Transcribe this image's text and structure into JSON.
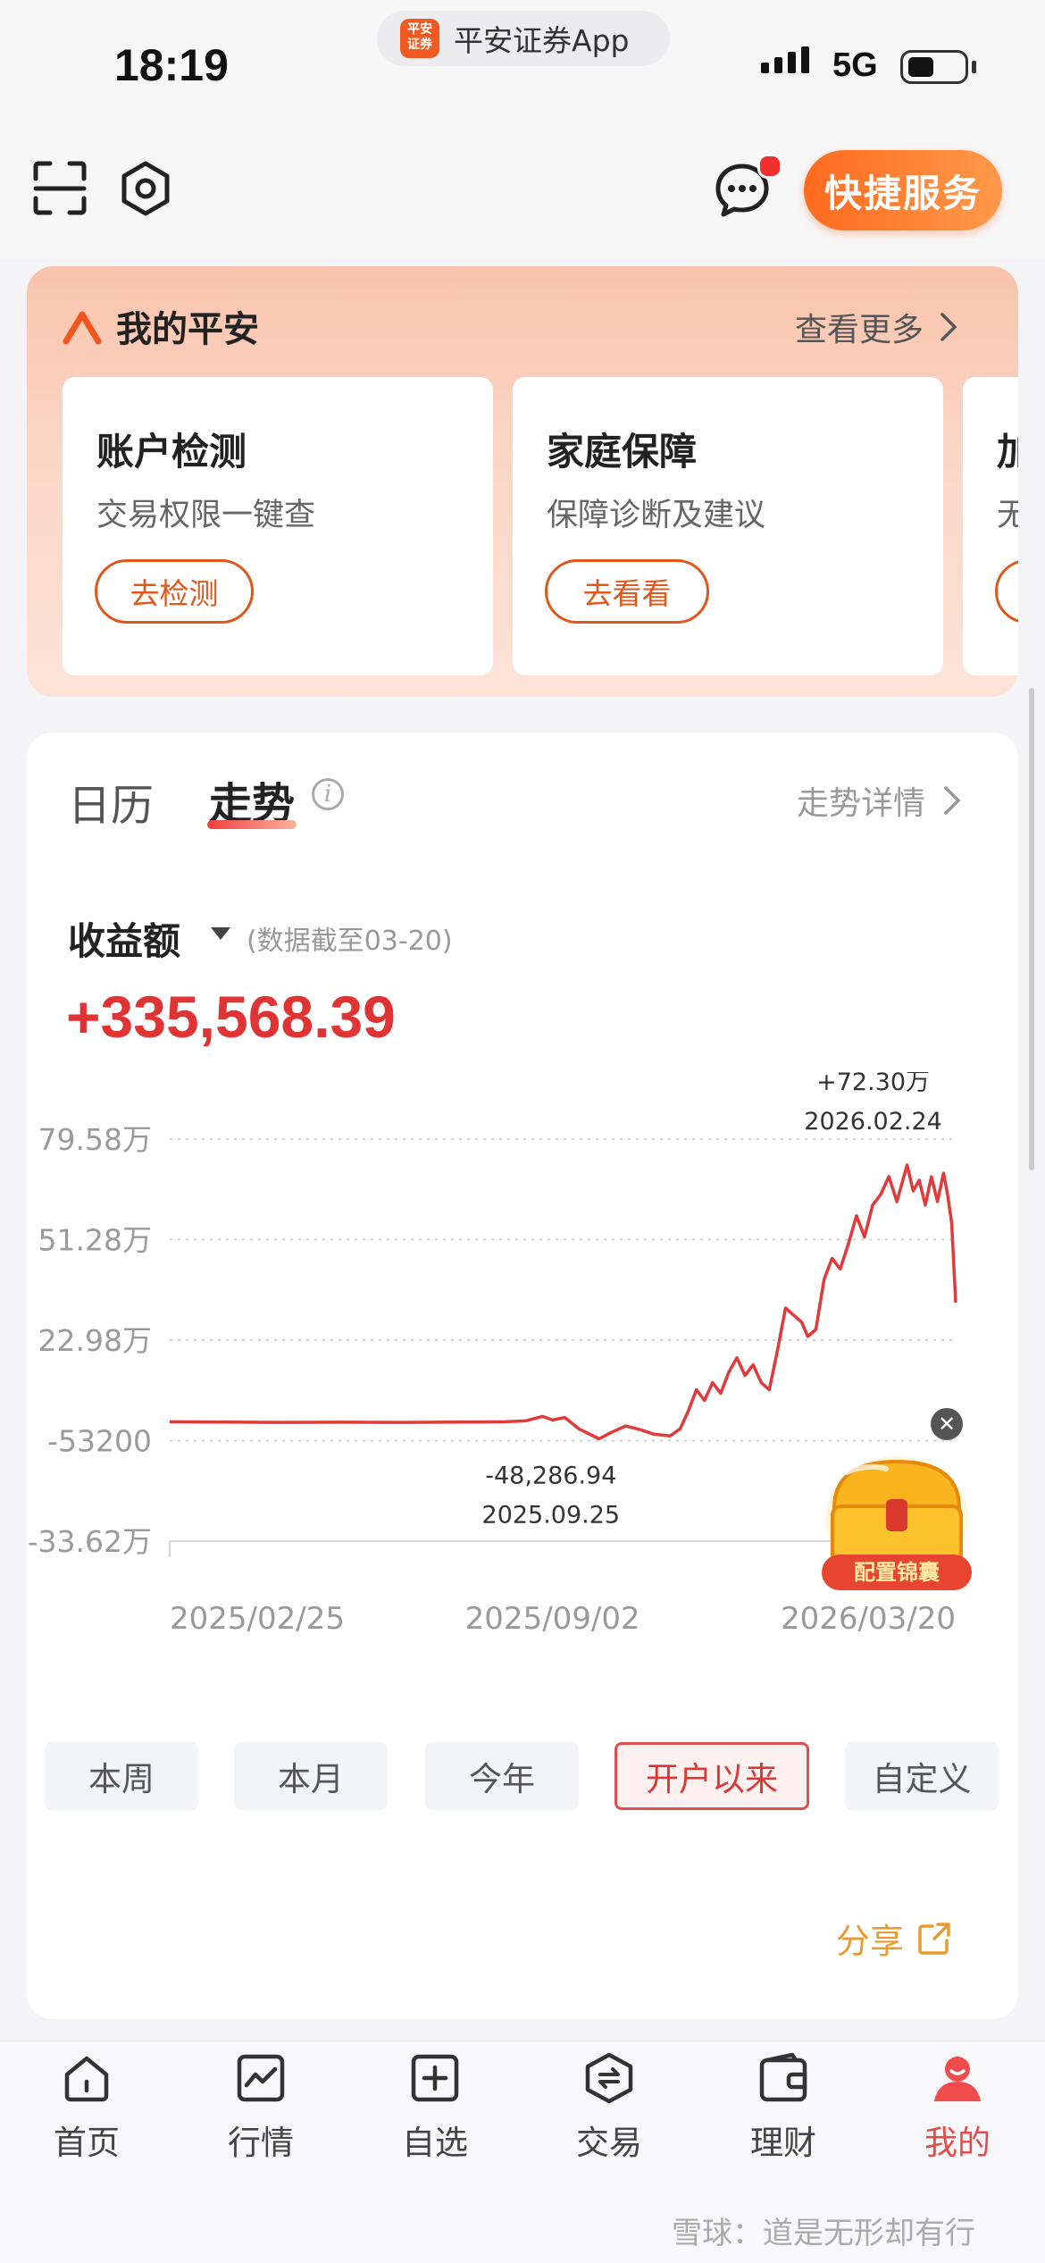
{
  "status_bar": {
    "time": "18:19",
    "app_badge_logo": "平安证券",
    "app_name": "平安证券App",
    "network": "5G"
  },
  "header": {
    "scan_icon": "scan-icon",
    "settings_icon": "settings-icon",
    "message_icon": "message-icon",
    "quick_service_label": "快捷服务"
  },
  "my_pingan": {
    "title": "我的平安",
    "more_label": "查看更多",
    "cards": [
      {
        "title": "账户检测",
        "desc": "交易权限一键查",
        "button": "去检测"
      },
      {
        "title": "家庭保障",
        "desc": "保障诊断及建议",
        "button": "去看看"
      },
      {
        "title": "加",
        "desc": "无",
        "button": ""
      }
    ]
  },
  "trend": {
    "tabs": [
      {
        "label": "日历"
      },
      {
        "label": "走势"
      }
    ],
    "active_tab": "走势",
    "detail_label": "走势详情",
    "metric": "收益额",
    "data_as_of": "(数据截至03-20)",
    "amount": "+335,568.39",
    "ranges": [
      "本周",
      "本月",
      "今年",
      "开户以来",
      "自定义"
    ],
    "active_range": "开户以来",
    "share_label": "分享",
    "promo_text": "配置锦囊"
  },
  "chart_data": {
    "type": "line",
    "y_tick_labels": [
      "79.58万",
      "51.28万",
      "22.98万",
      "-53200",
      "-33.62万"
    ],
    "y_ticks": [
      795800,
      512800,
      229800,
      -53200,
      -336200
    ],
    "ylim": [
      -336200,
      795800
    ],
    "x_tick_labels": [
      "2025/02/25",
      "2025/09/02",
      "2026/03/20"
    ],
    "xlim": [
      "2025-02-25",
      "2026-03-20"
    ],
    "grid": "dotted horizontal",
    "line_color": "#e03a3a",
    "annotations": [
      {
        "value_label": "+72.30万",
        "date_label": "2026.02.24",
        "x": "2026-02-24",
        "y": 723000
      },
      {
        "value_label": "-48,286.94",
        "date_label": "2025.09.25",
        "x": "2025-09-25",
        "y": -48286.94
      }
    ],
    "series": [
      {
        "points": [
          [
            "2025-02-25",
            0
          ],
          [
            "2025-03-20",
            -1000
          ],
          [
            "2025-04-20",
            -2000
          ],
          [
            "2025-05-20",
            -1500
          ],
          [
            "2025-06-20",
            -2000
          ],
          [
            "2025-07-20",
            -1000
          ],
          [
            "2025-08-10",
            0
          ],
          [
            "2025-08-20",
            3000
          ],
          [
            "2025-08-28",
            15000
          ],
          [
            "2025-09-02",
            5000
          ],
          [
            "2025-09-08",
            12000
          ],
          [
            "2025-09-15",
            -20000
          ],
          [
            "2025-09-25",
            -48287
          ],
          [
            "2025-10-01",
            -30000
          ],
          [
            "2025-10-08",
            -12000
          ],
          [
            "2025-10-15",
            -22000
          ],
          [
            "2025-10-22",
            -35000
          ],
          [
            "2025-10-30",
            -40000
          ],
          [
            "2025-11-04",
            -20000
          ],
          [
            "2025-11-08",
            30000
          ],
          [
            "2025-11-12",
            90000
          ],
          [
            "2025-11-16",
            60000
          ],
          [
            "2025-11-20",
            110000
          ],
          [
            "2025-11-24",
            80000
          ],
          [
            "2025-11-28",
            140000
          ],
          [
            "2025-12-02",
            180000
          ],
          [
            "2025-12-06",
            130000
          ],
          [
            "2025-12-10",
            160000
          ],
          [
            "2025-12-14",
            110000
          ],
          [
            "2025-12-18",
            90000
          ],
          [
            "2025-12-22",
            200000
          ],
          [
            "2025-12-26",
            320000
          ],
          [
            "2025-12-30",
            300000
          ],
          [
            "2026-01-03",
            280000
          ],
          [
            "2026-01-06",
            240000
          ],
          [
            "2026-01-10",
            260000
          ],
          [
            "2026-01-14",
            400000
          ],
          [
            "2026-01-18",
            460000
          ],
          [
            "2026-01-22",
            430000
          ],
          [
            "2026-01-26",
            500000
          ],
          [
            "2026-01-30",
            580000
          ],
          [
            "2026-02-03",
            520000
          ],
          [
            "2026-02-07",
            610000
          ],
          [
            "2026-02-11",
            640000
          ],
          [
            "2026-02-15",
            690000
          ],
          [
            "2026-02-19",
            620000
          ],
          [
            "2026-02-24",
            723000
          ],
          [
            "2026-02-27",
            650000
          ],
          [
            "2026-03-02",
            680000
          ],
          [
            "2026-03-05",
            610000
          ],
          [
            "2026-03-08",
            690000
          ],
          [
            "2026-03-11",
            620000
          ],
          [
            "2026-03-14",
            700000
          ],
          [
            "2026-03-16",
            640000
          ],
          [
            "2026-03-18",
            560000
          ],
          [
            "2026-03-20",
            335568
          ]
        ]
      }
    ]
  },
  "bottom_nav": {
    "items": [
      {
        "label": "首页",
        "icon": "home-icon"
      },
      {
        "label": "行情",
        "icon": "market-icon"
      },
      {
        "label": "自选",
        "icon": "watchlist-icon"
      },
      {
        "label": "交易",
        "icon": "trade-icon"
      },
      {
        "label": "理财",
        "icon": "wallet-icon"
      },
      {
        "label": "我的",
        "icon": "profile-icon"
      }
    ],
    "active": "我的"
  },
  "watermark": "雪球：道是无形却有行"
}
